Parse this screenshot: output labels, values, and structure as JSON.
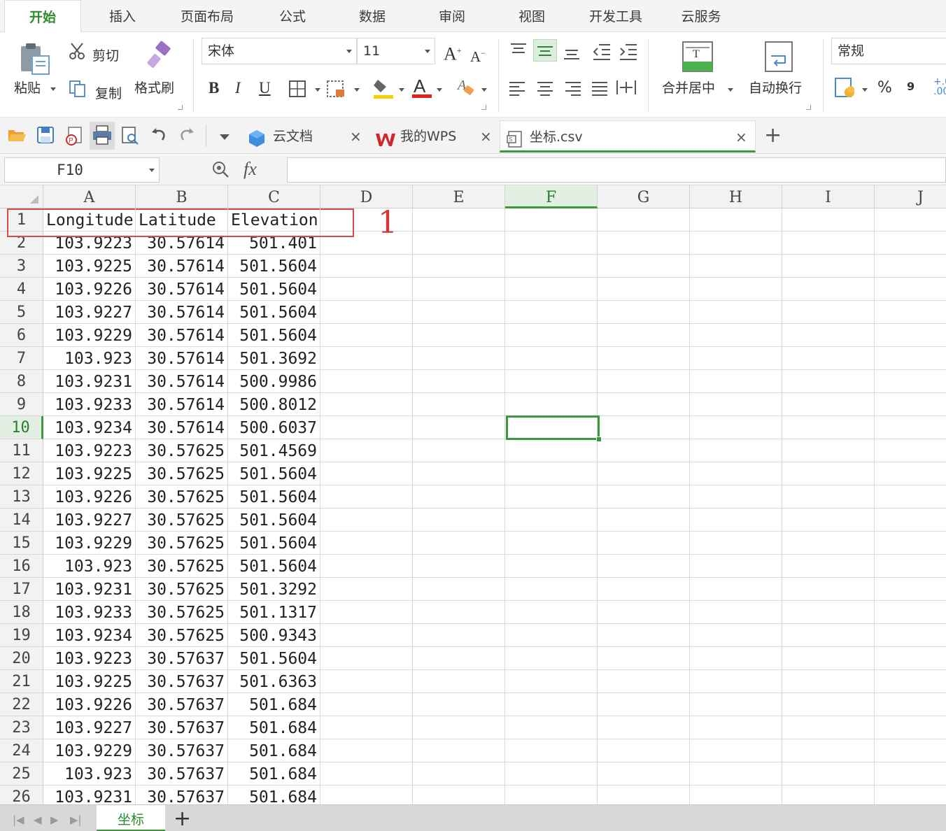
{
  "menu": {
    "tabs": [
      "开始",
      "插入",
      "页面布局",
      "公式",
      "数据",
      "审阅",
      "视图",
      "开发工具",
      "云服务"
    ],
    "active": "开始"
  },
  "ribbon": {
    "paste_label": "粘贴",
    "cut_label": "剪切",
    "copy_label": "复制",
    "format_painter_label": "格式刷",
    "font_name": "宋体",
    "font_size": "11",
    "bold_label": "B",
    "italic_label": "I",
    "underline_label": "U",
    "merge_center_label": "合并居中",
    "wrap_text_label": "自动换行",
    "number_format": "常规",
    "percent_label": "%",
    "comma_label": "9"
  },
  "tabbar": {
    "tabs": [
      {
        "label": "云文档",
        "icon": "cloud-doc-icon",
        "active": false
      },
      {
        "label": "我的WPS",
        "icon": "wps-logo-icon",
        "active": false
      },
      {
        "label": "坐标.csv",
        "icon": "csv-file-icon",
        "active": true
      }
    ],
    "close_glyph": "×",
    "new_tab_glyph": "+"
  },
  "formula_bar": {
    "name_box": "F10",
    "fx_label": "fx",
    "formula": ""
  },
  "sheet": {
    "columns": [
      "A",
      "B",
      "C",
      "D",
      "E",
      "F",
      "G",
      "H",
      "I",
      "J"
    ],
    "selected_column": "F",
    "selected_row": 10,
    "active_cell": "F10",
    "header_row": [
      "Longitude",
      "Latitude",
      "Elevation"
    ],
    "rows": [
      [
        "103.9223",
        "30.57614",
        "501.401"
      ],
      [
        "103.9225",
        "30.57614",
        "501.5604"
      ],
      [
        "103.9226",
        "30.57614",
        "501.5604"
      ],
      [
        "103.9227",
        "30.57614",
        "501.5604"
      ],
      [
        "103.9229",
        "30.57614",
        "501.5604"
      ],
      [
        "103.923",
        "30.57614",
        "501.3692"
      ],
      [
        "103.9231",
        "30.57614",
        "500.9986"
      ],
      [
        "103.9233",
        "30.57614",
        "500.8012"
      ],
      [
        "103.9234",
        "30.57614",
        "500.6037"
      ],
      [
        "103.9223",
        "30.57625",
        "501.4569"
      ],
      [
        "103.9225",
        "30.57625",
        "501.5604"
      ],
      [
        "103.9226",
        "30.57625",
        "501.5604"
      ],
      [
        "103.9227",
        "30.57625",
        "501.5604"
      ],
      [
        "103.9229",
        "30.57625",
        "501.5604"
      ],
      [
        "103.923",
        "30.57625",
        "501.5604"
      ],
      [
        "103.9231",
        "30.57625",
        "501.3292"
      ],
      [
        "103.9233",
        "30.57625",
        "501.1317"
      ],
      [
        "103.9234",
        "30.57625",
        "500.9343"
      ],
      [
        "103.9223",
        "30.57637",
        "501.5604"
      ],
      [
        "103.9225",
        "30.57637",
        "501.6363"
      ],
      [
        "103.9226",
        "30.57637",
        "501.684"
      ],
      [
        "103.9227",
        "30.57637",
        "501.684"
      ],
      [
        "103.9229",
        "30.57637",
        "501.684"
      ],
      [
        "103.923",
        "30.57637",
        "501.684"
      ],
      [
        "103.9231",
        "30.57637",
        "501.684"
      ]
    ],
    "annotation_label": "1"
  },
  "sheet_tabs": {
    "tabs": [
      "坐标"
    ],
    "add_glyph": "+"
  },
  "colors": {
    "accent_green": "#3a9a3a",
    "annotation_red": "#d23a3a",
    "wps_red": "#d0262c"
  }
}
